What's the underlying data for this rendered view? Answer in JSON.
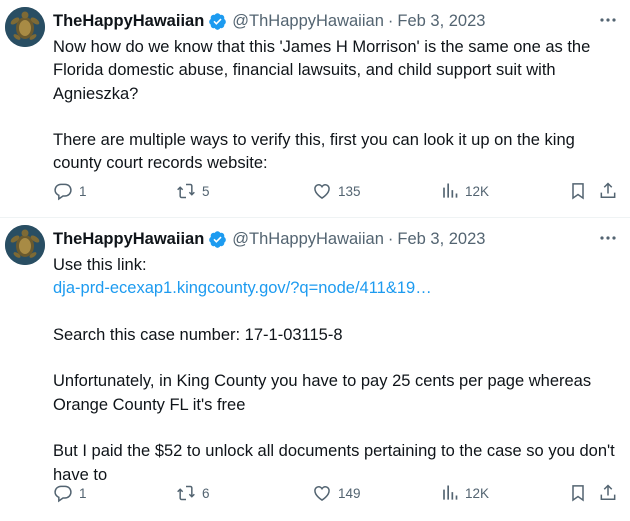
{
  "tweets": [
    {
      "display_name": "TheHappyHawaiian",
      "handle": "@ThHappyHawaiian",
      "separator": "·",
      "date": "Feb 3, 2023",
      "lines": [
        "Now how do we know that this 'James H Morrison' is the same one as the",
        "Florida domestic abuse, financial lawsuits, and child support suit with",
        "Agnieszka?",
        "",
        "There are multiple ways to verify this, first you can look it up on the king",
        "county court records website:"
      ],
      "replies": "1",
      "retweets": "5",
      "likes": "135",
      "views": "12K"
    },
    {
      "display_name": "TheHappyHawaiian",
      "handle": "@ThHappyHawaiian",
      "separator": "·",
      "date": "Feb 3, 2023",
      "line_use": "Use this link:",
      "link": "dja-prd-ecexap1.kingcounty.gov/?q=node/411&19…",
      "line_case": "Search this case number: 17-1-03115-8",
      "line_unf_1": "Unfortunately, in King County you have to pay 25 cents per page whereas",
      "line_unf_2": "Orange County FL it's free",
      "line_paid_1": "But I paid the $52 to unlock all documents pertaining to the case so you don't",
      "line_paid_2": "have to",
      "replies": "1",
      "retweets": "6",
      "likes": "149",
      "views": "12K"
    }
  ],
  "icons": {
    "avatar": "sea-turtle-avatar",
    "verified": "verified-badge-icon",
    "more": "more-icon",
    "reply": "reply-icon",
    "retweet": "retweet-icon",
    "like": "heart-icon",
    "views": "views-icon",
    "bookmark": "bookmark-icon",
    "share": "share-icon"
  },
  "colors": {
    "text": "#0f1419",
    "secondary": "#536471",
    "link": "#1d9bf0",
    "verified": "#1d9bf0"
  }
}
